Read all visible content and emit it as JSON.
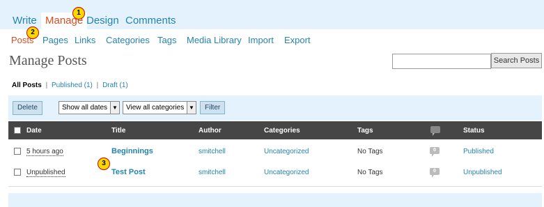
{
  "topnav": {
    "tabs": [
      {
        "label": "Write"
      },
      {
        "label": "Manage"
      },
      {
        "label": "Design"
      },
      {
        "label": "Comments"
      }
    ]
  },
  "subnav": {
    "items": [
      {
        "label": "Posts"
      },
      {
        "label": "Pages"
      },
      {
        "label": "Links"
      },
      {
        "label": "Categories"
      },
      {
        "label": "Tags"
      },
      {
        "label": "Media Library"
      },
      {
        "label": "Import"
      },
      {
        "label": "Export"
      }
    ]
  },
  "page": {
    "title": "Manage Posts"
  },
  "search": {
    "value": "",
    "button_label": "Search Posts"
  },
  "filters": {
    "all": "All Posts",
    "published": "Published (1)",
    "draft": "Draft (1)"
  },
  "tablenav": {
    "delete_label": "Delete",
    "dates_select": "Show all dates",
    "categories_select": "View all categories",
    "filter_label": "Filter"
  },
  "table": {
    "headers": {
      "date": "Date",
      "title": "Title",
      "author": "Author",
      "categories": "Categories",
      "tags": "Tags",
      "status": "Status"
    },
    "rows": [
      {
        "date": "5 hours ago",
        "title": "Beginnings",
        "author": "smitchell",
        "categories": "Uncategorized",
        "tags": "No Tags",
        "comments": "0",
        "status": "Published"
      },
      {
        "date": "Unpublished",
        "title": "Test Post",
        "author": "smitchell",
        "categories": "Uncategorized",
        "tags": "No Tags",
        "comments": "0",
        "status": "Unpublished"
      }
    ]
  },
  "callouts": {
    "one": "1",
    "two": "2",
    "three": "3"
  },
  "colors": {
    "accent": "#d54e21",
    "link": "#2583ad",
    "nav_bg": "#e4f2fd",
    "header_bg": "#464646"
  }
}
